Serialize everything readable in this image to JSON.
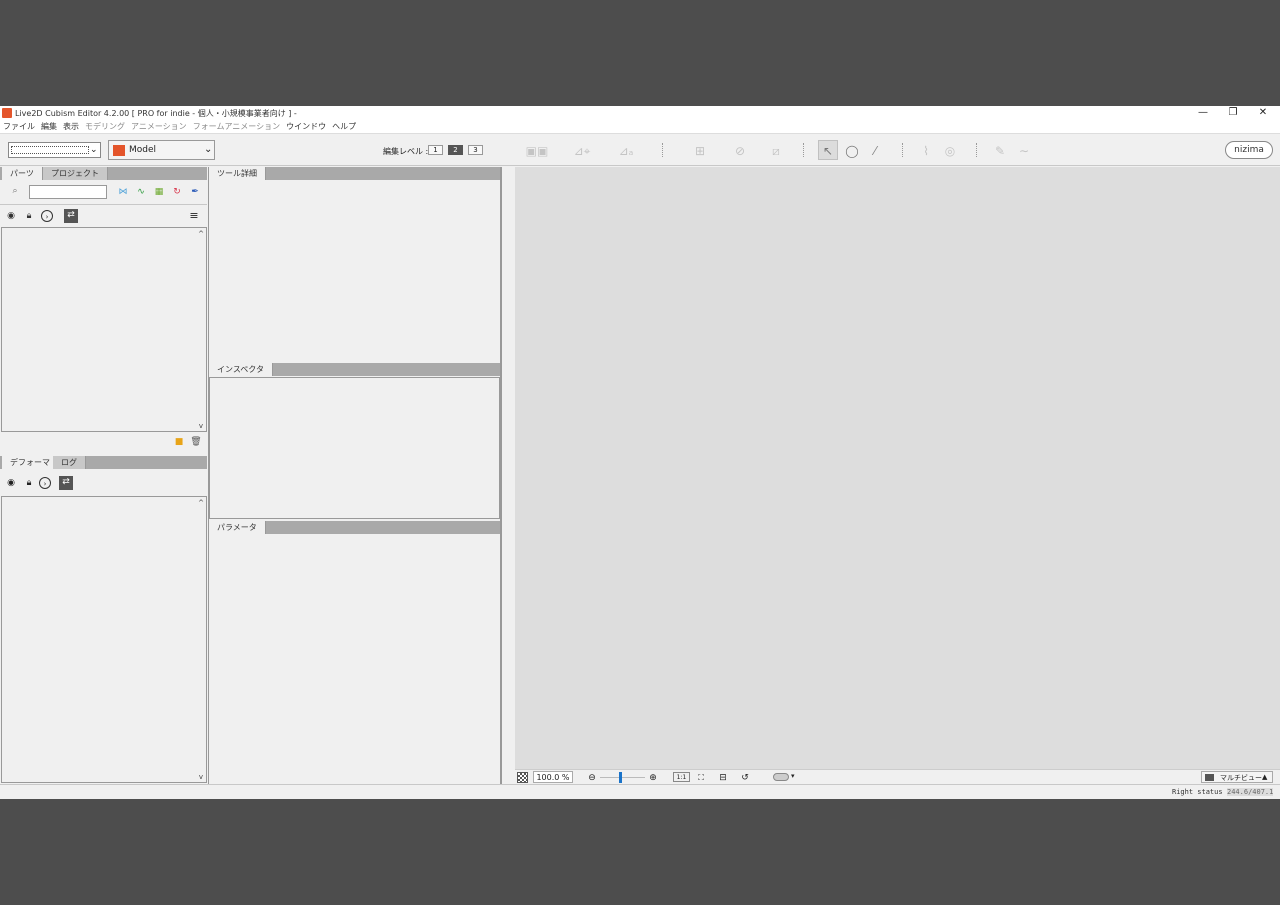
{
  "window": {
    "title": "Live2D Cubism Editor 4.2.00   [ PRO for indie - 個人・小規模事業者向け ]  -",
    "minimize": "—",
    "restore": "❐",
    "close": "✕"
  },
  "menu": [
    "ファイル",
    "編集",
    "表示",
    "モデリング",
    "アニメーション",
    "フォームアニメーション",
    "ウインドウ",
    "ヘルプ"
  ],
  "toolbar": {
    "model_select": "Model",
    "edit_level_label": "編集レベル :",
    "edit_levels": [
      "1",
      "2",
      "3"
    ],
    "selected_level": "2",
    "nizima": "nizima"
  },
  "parts_panel": {
    "tabs": [
      "パーツ",
      "プロジェクト"
    ]
  },
  "tool_detail_panel": {
    "tab": "ツール詳細"
  },
  "inspector_panel": {
    "tab": "インスペクタ"
  },
  "parameter_panel": {
    "tab": "パラメータ"
  },
  "deformer_panel": {
    "tabs": [
      "デフォーマ",
      "ログ"
    ]
  },
  "viewport": {
    "zoom": "100.0 %",
    "ratio": "1:1",
    "multiview": "マルチビュー"
  },
  "status": {
    "right_status": "Right status",
    "coords": "244.6/407.1"
  },
  "colors": {
    "accent_blue": "#1a73c9",
    "logo_orange": "#e4552b"
  }
}
